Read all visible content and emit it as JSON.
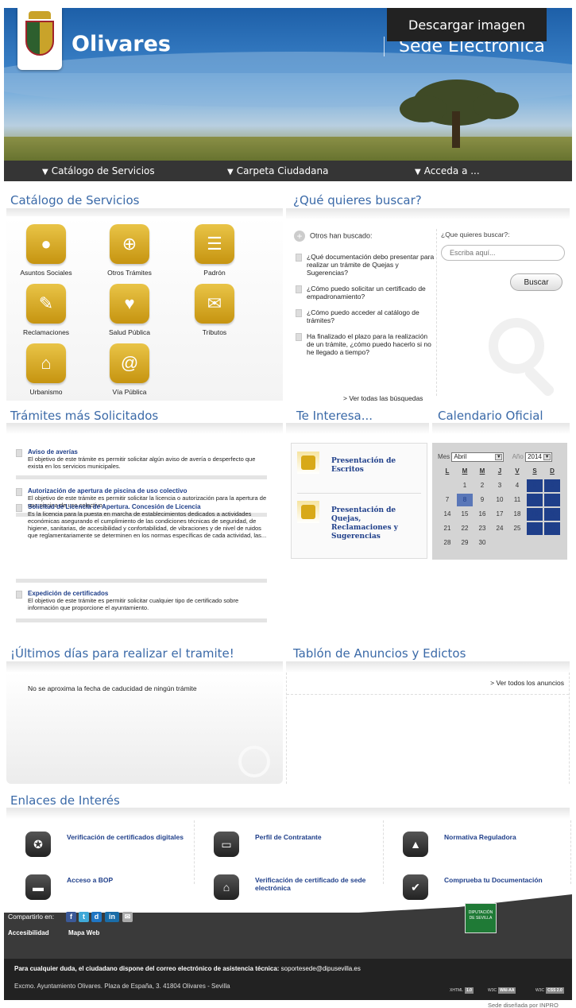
{
  "header": {
    "site_name": "Olivares",
    "sede_title": "Sede Electrónica",
    "download_label": "Descargar imagen"
  },
  "nav": {
    "items": [
      {
        "label": "Catálogo de Servicios"
      },
      {
        "label": "Carpeta Ciudadana"
      },
      {
        "label": "Acceda a ..."
      }
    ]
  },
  "catalog": {
    "title": "Catálogo de Servicios",
    "items": [
      {
        "label": "Asuntos Sociales",
        "icon": "people-icon"
      },
      {
        "label": "Otros Trámites",
        "icon": "folder-plus-icon"
      },
      {
        "label": "Padrón",
        "icon": "register-icon"
      },
      {
        "label": "Reclamaciones",
        "icon": "speech-bubble-icon"
      },
      {
        "label": "Salud Pública",
        "icon": "heart-icon"
      },
      {
        "label": "Tributos",
        "icon": "briefcase-icon"
      },
      {
        "label": "Urbanismo",
        "icon": "house-icon"
      },
      {
        "label": "Vía Pública",
        "icon": "at-icon"
      }
    ],
    "accent": "#d4a61b"
  },
  "search": {
    "title": "¿Qué quieres buscar?",
    "others_label": "Otros han buscado:",
    "questions": [
      "¿Qué documentación debo presentar para realizar un trámite de Quejas y Sugerencias?",
      "¿Cómo puedo solicitar un certificado de empadronamiento?",
      "¿Cómo puedo acceder al catálogo de trámites?",
      "Ha finalizado el plazo para la realización de un trámite, ¿cómo puedo hacerlo si no he llegado a tiempo?"
    ],
    "see_all": "> Ver todas las búsquedas",
    "right_label": "¿Que quieres buscar?:",
    "placeholder": "Escriba aquí...",
    "button": "Buscar"
  },
  "tramites": {
    "title": "Trámites más Solicitados",
    "items": [
      {
        "title": "Aviso de averías",
        "text": "El objetivo de este trámite es permitir solicitar algún aviso de avería o desperfecto que exista en los servicios municipales."
      },
      {
        "title": "Autorización de apertura de piscina de uso colectivo",
        "text": "El objetivo de este trámite es permitir solicitar la licencia o autorización para la apertura de una piscina de uso colectivo."
      },
      {
        "title": "Solicitud de Licencia de Apertura. Concesión de Licencia",
        "text": "Es la licencia para la puesta en marcha de establecimientos dedicados a actividades económicas asegurando el cumplimiento de las condiciones técnicas de seguridad, de higiene, sanitarias, de accesibilidad y confortabilidad, de vibraciones y de nivel de ruidos que reglamentariamente se determinen en los normas específicas de cada actividad, las..."
      },
      {
        "title": "Expedición de certificados",
        "text": "El objetivo de este trámite es permitir solicitar cualquier tipo de certificado sobre información que proporcione el ayuntamiento."
      }
    ]
  },
  "interesa": {
    "title": "Te Interesa...",
    "items": [
      {
        "label": "Presentación de Escritos"
      },
      {
        "label": "Presentación de Quejas, Reclamaciones y Sugerencias"
      }
    ]
  },
  "calendar": {
    "title": "Calendario Oficial",
    "month_label": "Mes",
    "month_value": "Abril",
    "year_label": "Año",
    "year_value": "2014",
    "weekdays": [
      "L",
      "M",
      "M",
      "J",
      "V",
      "S",
      "D"
    ],
    "first_weekday_index": 1,
    "days_in_month": 30,
    "highlighted_days": [
      5,
      6,
      8,
      12,
      13,
      19,
      20,
      26,
      27
    ],
    "today": 8
  },
  "ultimos": {
    "title": "¡Últimos días para realizar el tramite!",
    "message": "No se aproxima la fecha de caducidad de ningún trámite"
  },
  "tablon": {
    "title": "Tablón de Anuncios y Edictos",
    "see_all": "> Ver todos los anuncios"
  },
  "enlaces": {
    "title": "Enlaces de Interés",
    "items": [
      {
        "label": "Verificación de certificados digitales",
        "icon": "certificate-icon"
      },
      {
        "label": "Perfil de Contratante",
        "icon": "id-card-icon"
      },
      {
        "label": "Normativa Reguladora",
        "icon": "graduation-cap-icon"
      },
      {
        "label": "Acceso a BOP",
        "icon": "book-icon"
      },
      {
        "label": "Verificación de certificado de sede electrónica",
        "icon": "building-icon"
      },
      {
        "label": "Comprueba tu Documentación",
        "icon": "document-check-icon"
      }
    ]
  },
  "footer": {
    "share_label": "Compartirlo en:",
    "accessibility": "Accesibilidad",
    "site_map": "Mapa Web",
    "contact_prefix": "Para cualquier duda, el ciudadano dispone del correo electrónico de asistencia técnica:",
    "contact_email": "soportesede@dipusevilla.es",
    "address": "Excmo. Ayuntamiento Olivares. Plaza de España, 3. 41804 Olivares - Sevilla",
    "designed_by": "Sede diseñada por INPRO",
    "badges": [
      {
        "name": "XHTML",
        "value": "1.0"
      },
      {
        "name": "W3C",
        "value": "WAI-AA"
      },
      {
        "name": "W3C",
        "value": "CSS 2.0"
      }
    ],
    "diputacion_logo_text": "DIPUTACIÓN DE SEVILLA"
  },
  "colors": {
    "title_blue": "#3b6aa8",
    "link_blue": "#1f3f8a",
    "nav_bg": "#353535"
  }
}
